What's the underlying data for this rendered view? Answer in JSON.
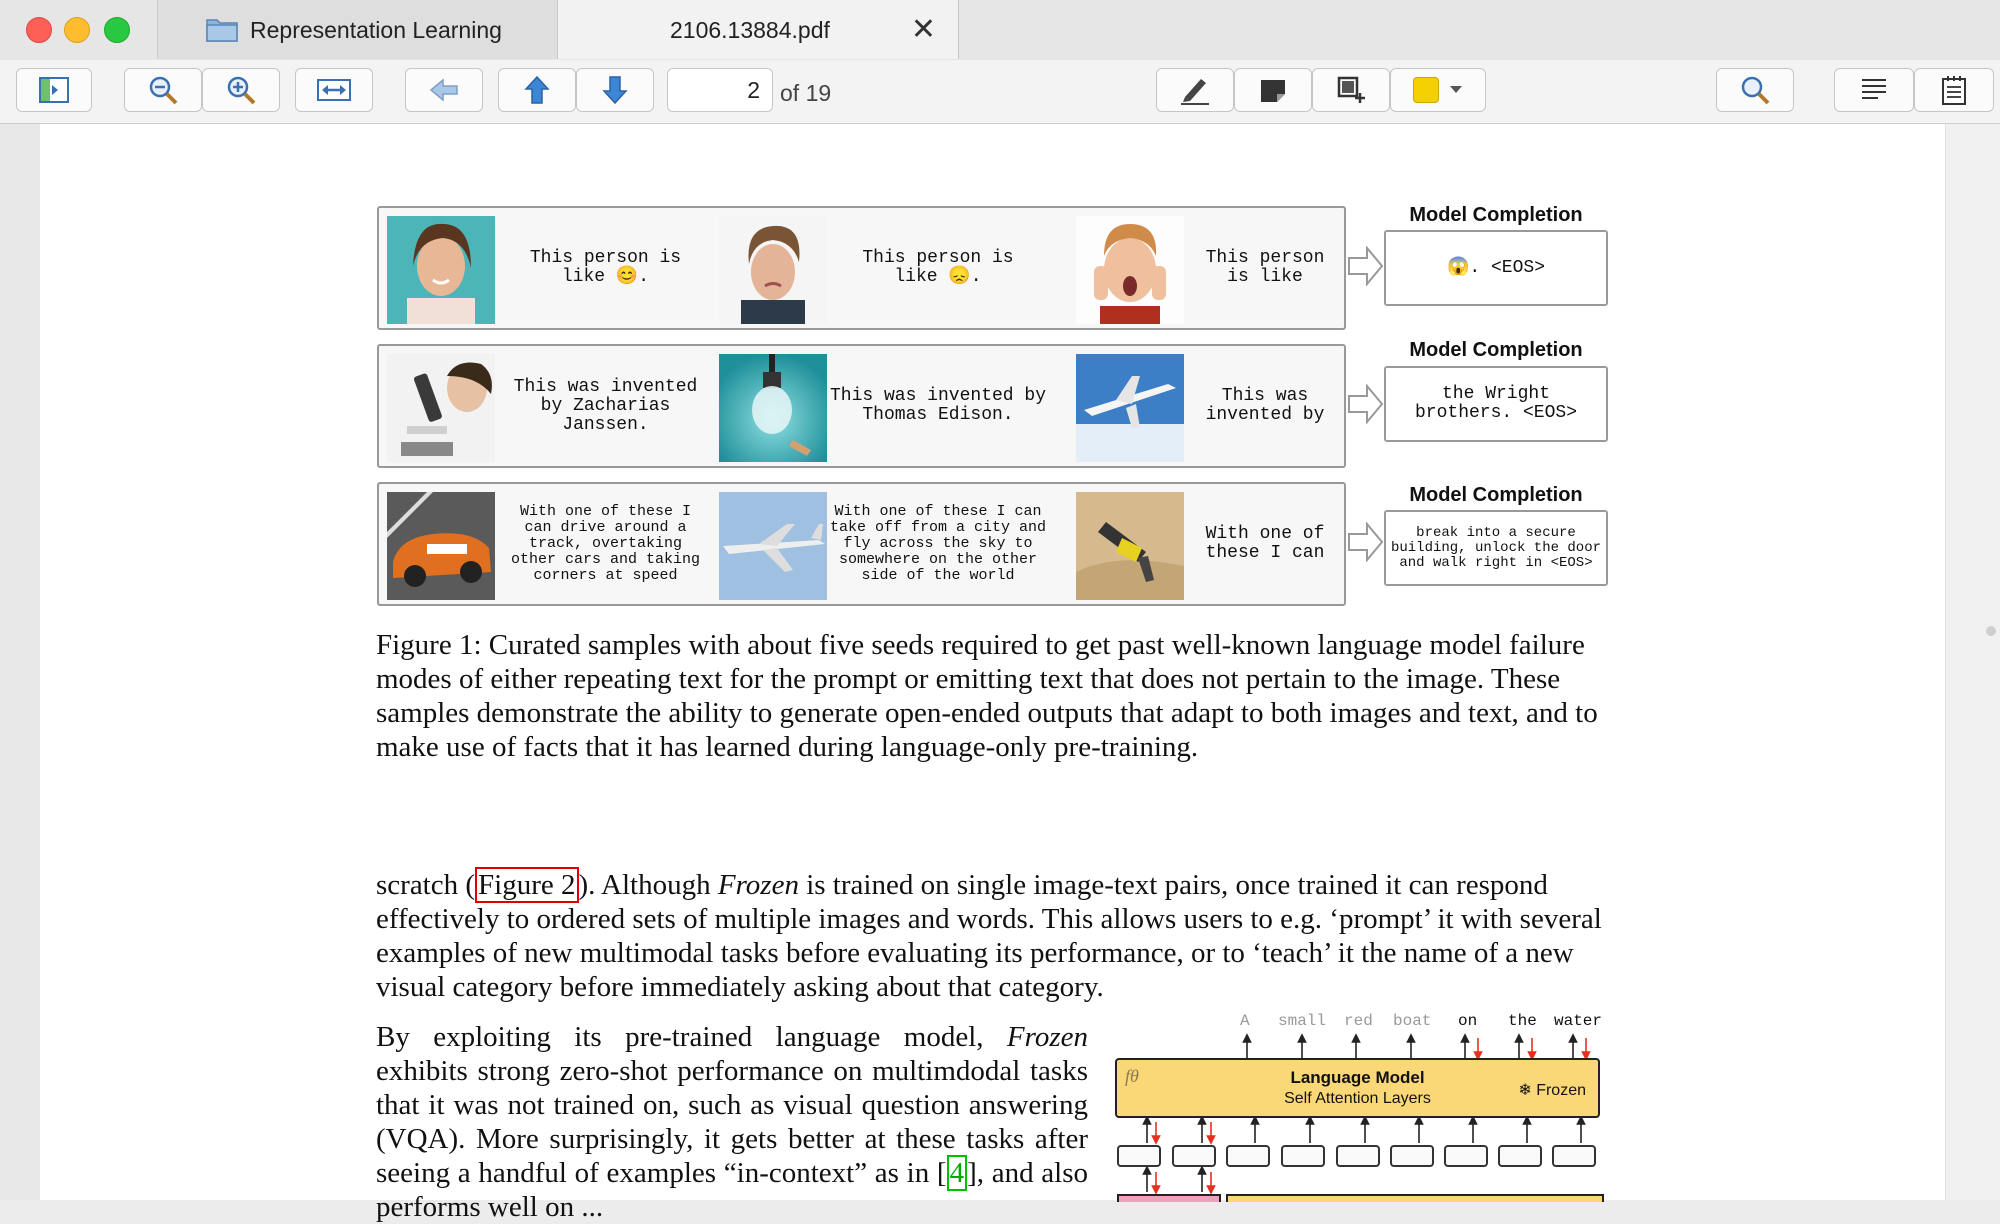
{
  "window": {
    "tabs": [
      {
        "label": "Representation Learning"
      },
      {
        "label": "2106.13884.pdf"
      }
    ]
  },
  "toolbar": {
    "page_current": "2",
    "page_total": "of 19",
    "highlight_color": "#f5d000",
    "icons": [
      "sidebar-icon",
      "zoom-out-icon",
      "zoom-in-icon",
      "fit-width-icon",
      "back-icon",
      "previous-page-icon",
      "next-page-icon",
      "pen-icon",
      "note-icon",
      "crop-icon",
      "color-swatch-icon",
      "search-icon",
      "text-view-icon",
      "notes-icon"
    ]
  },
  "figure1": {
    "rows": [
      {
        "captions": [
          "This person is\nlike 😊.",
          "This person is\nlike 😞.",
          "This person\nis like"
        ],
        "completion_title": "Model Completion",
        "completion": "😱. <EOS>"
      },
      {
        "captions": [
          "This was invented\nby Zacharias\nJanssen.",
          "This was invented by\nThomas Edison.",
          "This was\ninvented by"
        ],
        "completion_title": "Model Completion",
        "completion": "the Wright\nbrothers. <EOS>"
      },
      {
        "captions": [
          "With one of these I\ncan drive around a\ntrack, overtaking\nother cars and taking\ncorners at speed",
          "With one of these I can\ntake off from a city and\nfly across the sky to\nsomewhere on the other\nside of the world",
          "With one of\nthese I can"
        ],
        "completion_title": "Model Completion",
        "completion": "break into a secure\nbuilding, unlock the door\nand walk right in  <EOS>"
      }
    ],
    "caption": "Figure 1: Curated samples with about five seeds required to get past well-known language model failure modes of either repeating text for the prompt or emitting text that does not pertain to the image. These samples demonstrate the ability to generate open-ended outputs that adapt to both images and text, and to make use of facts that it has learned during language-only pre-training."
  },
  "body": {
    "para1_a": "scratch (",
    "para1_ref": "Figure 2",
    "para1_b": "). Although ",
    "para1_italic": "Frozen",
    "para1_c": " is trained on single image-text pairs, once trained it can respond effectively to ordered sets of multiple images and words. This allows users to e.g. ‘prompt’ it with several examples of new multimodal tasks before evaluating its performance, or to ‘teach’ it the name of a new visual category before immediately asking about that category.",
    "para2_a": "By exploiting its pre-trained language model, ",
    "para2_italic": "Frozen",
    "para2_b": " exhibits strong zero-shot performance on multimdodal tasks that it was not trained on, such as visual question answering (VQA). More surprisingly, it gets better at these tasks after seeing a handful of examples “in-context” as in [",
    "para2_ref": "4",
    "para2_c": "], and also performs well on ..."
  },
  "figure2": {
    "tokens": [
      "A",
      "small",
      "red",
      "boat",
      "on",
      "the",
      "water"
    ],
    "lm_symbol": "fθ",
    "lm_title": "Language Model",
    "lm_subtitle": "Self Attention Layers",
    "lm_frozen": "❄ Frozen"
  }
}
